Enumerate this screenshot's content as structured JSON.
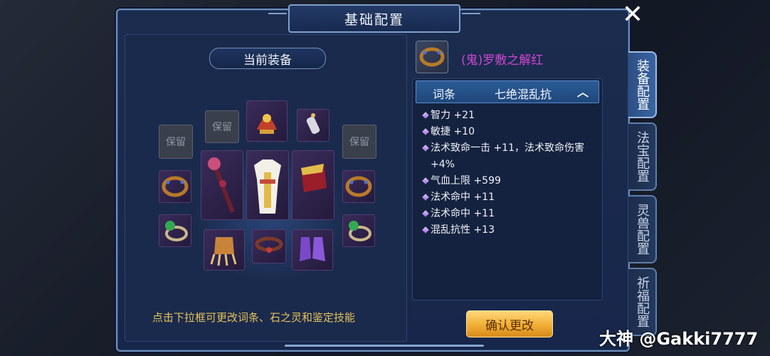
{
  "window": {
    "title": "基础配置",
    "close_icon": "close-icon"
  },
  "equip_panel": {
    "title": "当前装备",
    "reserve_label": "保留",
    "hint": "点击下拉框可更改词条、石之灵和鉴定技能"
  },
  "item": {
    "name": "(鬼)罗敷之解红",
    "name_color": "#cf46cf",
    "icon": "bracelet-icon"
  },
  "dropdown": {
    "label": "词条",
    "value": "七绝混乱抗",
    "chevron": "chevron-up-icon"
  },
  "attributes": [
    "智力 +21",
    "敏捷 +10",
    "法术致命一击 +11，法术致命伤害 +4%",
    "气血上限 +599",
    "法术命中 +11",
    "法术命中 +11",
    "混乱抗性 +13"
  ],
  "confirm_button": "确认更改",
  "tabs": [
    {
      "label": "装备配置",
      "active": true
    },
    {
      "label": "法宝配置",
      "active": false
    },
    {
      "label": "灵兽配置",
      "active": false
    },
    {
      "label": "祈福配置",
      "active": false
    }
  ],
  "watermark": "大神 @Gakki7777",
  "colors": {
    "accent": "#f0ae35",
    "hint": "#e6c25a",
    "panel": "#17264a"
  }
}
